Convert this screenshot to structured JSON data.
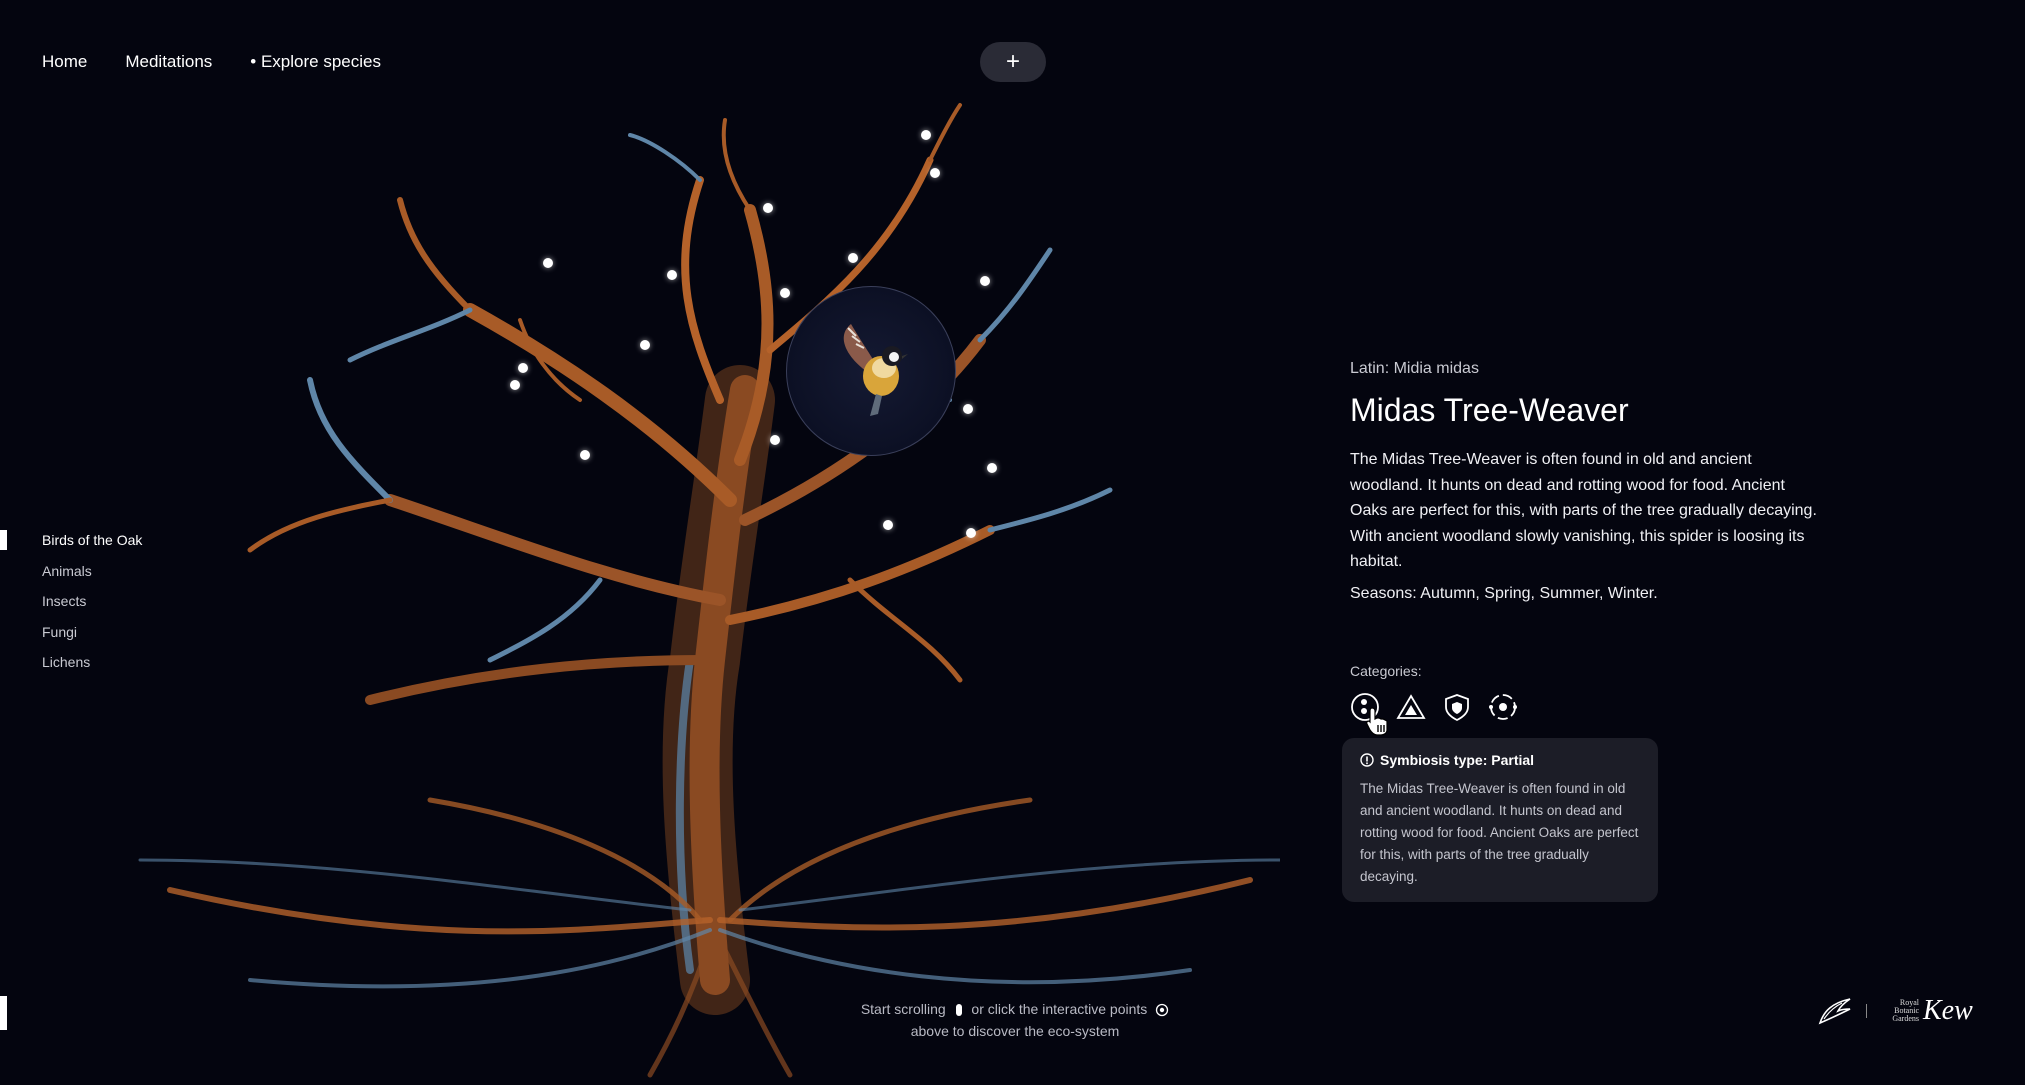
{
  "nav": {
    "home": "Home",
    "meditations": "Meditations",
    "explore": "• Explore species",
    "plus": "+"
  },
  "sidebar": {
    "items": [
      {
        "label": "Birds of the Oak"
      },
      {
        "label": "Animals"
      },
      {
        "label": "Insects"
      },
      {
        "label": "Fungi"
      },
      {
        "label": "Lichens"
      }
    ]
  },
  "species": {
    "latin": "Latin: Midia midas",
    "name": "Midas Tree-Weaver",
    "description": "The Midas Tree-Weaver is often found in old and ancient woodland. It hunts on dead and rotting wood for food. Ancient Oaks are perfect for this, with parts of the tree gradually decaying. With ancient woodland slowly vanishing, this spider is loosing its habitat.",
    "seasons": "Seasons: Autumn, Spring, Summer, Winter.",
    "categories_label": "Categories:"
  },
  "tooltip": {
    "title": "Symbiosis type: Partial",
    "body": "The Midas Tree-Weaver is often found in old and ancient woodland. It hunts on dead and rotting wood for food. Ancient Oaks are perfect for this, with parts of the tree gradually decaying."
  },
  "hint": {
    "line1a": "Start scrolling",
    "line1b": "or click the interactive points",
    "line2": "above to discover the eco-system"
  },
  "logo": {
    "small": "Royal Botanic Gardens",
    "big": "Kew"
  },
  "colors": {
    "background": "#04050f",
    "branch_orange": "#b5622a",
    "branch_blue": "#5f86a8",
    "tooltip_bg": "#1c1d27"
  }
}
